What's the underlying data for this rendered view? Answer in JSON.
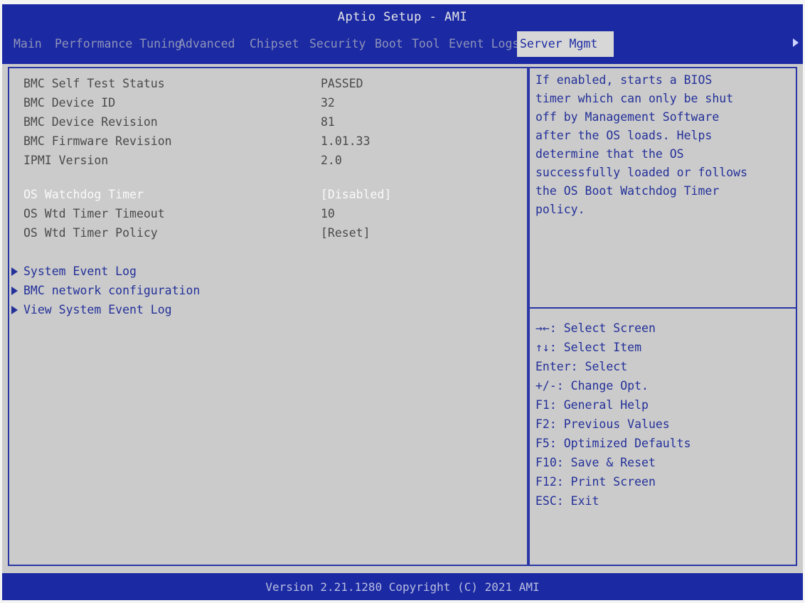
{
  "window": {
    "title": "Aptio Setup - AMI"
  },
  "tabs": [
    {
      "label": "Main",
      "active": false
    },
    {
      "label": "Performance Tuning",
      "active": false
    },
    {
      "label": "Advanced",
      "active": false
    },
    {
      "label": "Chipset",
      "active": false
    },
    {
      "label": "Security",
      "active": false
    },
    {
      "label": "Boot",
      "active": false
    },
    {
      "label": "Tool",
      "active": false
    },
    {
      "label": "Event Logs",
      "active": false
    },
    {
      "label": "Server Mgmt",
      "active": true
    }
  ],
  "info_rows": [
    {
      "label": "BMC Self Test Status",
      "value": "PASSED"
    },
    {
      "label": "BMC Device ID",
      "value": "32"
    },
    {
      "label": "BMC Device Revision",
      "value": "81"
    },
    {
      "label": "BMC Firmware Revision",
      "value": "1.01.33"
    },
    {
      "label": "IPMI Version",
      "value": "2.0"
    }
  ],
  "settings": [
    {
      "label": "OS Watchdog Timer",
      "value": "[Disabled]",
      "selected": true
    },
    {
      "label": "OS Wtd Timer Timeout",
      "value": "10",
      "selected": false
    },
    {
      "label": "OS Wtd Timer Policy",
      "value": "[Reset]",
      "selected": false
    }
  ],
  "submenus": [
    {
      "label": "System Event Log"
    },
    {
      "label": "BMC network configuration"
    },
    {
      "label": "View System Event Log"
    }
  ],
  "help": {
    "text": "If enabled, starts a BIOS\ntimer which can only be shut\noff by Management Software\nafter the OS loads.  Helps\ndetermine that the OS\nsuccessfully loaded or follows\nthe OS Boot Watchdog Timer\npolicy."
  },
  "keys": [
    "→←: Select Screen",
    "↑↓: Select Item",
    "Enter: Select",
    "+/-: Change Opt.",
    "F1: General Help",
    "F2: Previous Values",
    "F5: Optimized Defaults",
    "F10: Save & Reset",
    "F12: Print Screen",
    "ESC: Exit"
  ],
  "footer": {
    "text": "Version 2.21.1280 Copyright (C) 2021 AMI"
  },
  "colors": {
    "header_bg": "#1b2aa3",
    "panel_bg": "#cbcbcb",
    "accent_text": "#233099"
  }
}
